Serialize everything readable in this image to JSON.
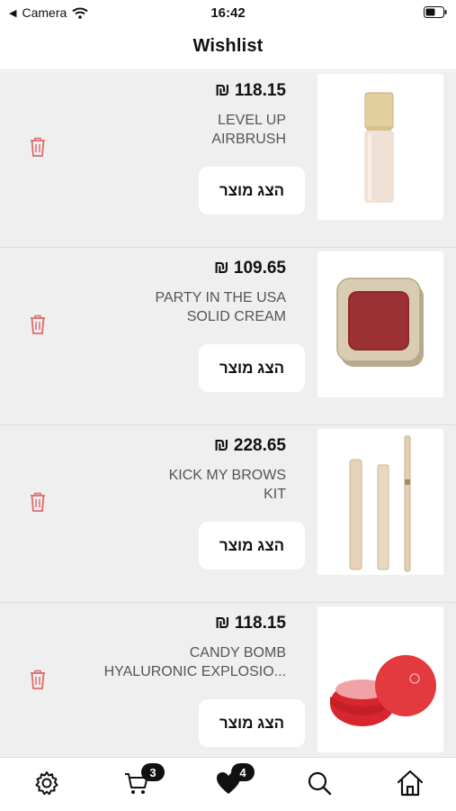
{
  "status": {
    "back_app": "Camera",
    "time": "16:42"
  },
  "nav": {
    "title": "Wishlist"
  },
  "items": [
    {
      "price": "₪ 118.15",
      "name_line1": "LEVEL UP",
      "name_line2": "AIRBRUSH",
      "button": "הצג מוצר"
    },
    {
      "price": "₪ 109.65",
      "name_line1": "PARTY IN THE USA",
      "name_line2": "SOLID CREAM",
      "button": "הצג מוצר"
    },
    {
      "price": "₪ 228.65",
      "name_line1": "KICK MY BROWS",
      "name_line2": "KIT",
      "button": "הצג מוצר"
    },
    {
      "price": "₪ 118.15",
      "name_line1": "CANDY BOMB",
      "name_line2": "HYALURONIC EXPLOSIO...",
      "button": "הצג מוצר"
    }
  ],
  "tabbar": {
    "cart_count": "3",
    "wishlist_count": "4"
  },
  "colors": {
    "trash": "#e06a6a",
    "bg": "#efefef"
  }
}
